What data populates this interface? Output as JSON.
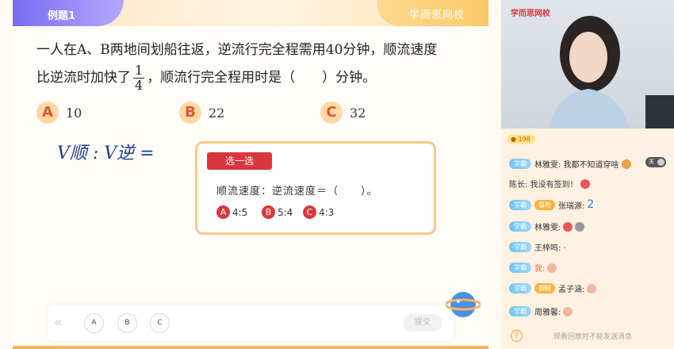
{
  "slide": {
    "tab_label": "例题1",
    "brand": "学而思网校",
    "question_line1": "一人在A、B两地间划船往返，逆流行完全程需用40分钟，顺流速度",
    "question_line2_pre": "比逆流时加快了",
    "fraction": {
      "numerator": "1",
      "denominator": "4"
    },
    "question_line2_post": "，顺流行完全程用时是（　　）分钟。",
    "options": [
      {
        "letter": "A",
        "value": "10"
      },
      {
        "letter": "B",
        "value": "22"
      },
      {
        "letter": "C",
        "value": "32"
      }
    ],
    "handwriting_text": "V顺 : V逆 =",
    "quiz": {
      "tag": "选一选",
      "prompt": "顺流速度：逆流速度＝（　　）。",
      "choices": [
        {
          "letter": "A",
          "value": "4:5"
        },
        {
          "letter": "B",
          "value": "5:4"
        },
        {
          "letter": "C",
          "value": "4:3"
        }
      ]
    },
    "answer_bar": {
      "collapse_icon": "double-chevron-left-icon",
      "buttons": [
        "A",
        "B",
        "C"
      ],
      "submit_label": "提交"
    }
  },
  "panel": {
    "video_brand": "学而思网校",
    "viewer_count": "198",
    "toggle_label": "关",
    "messages": [
      {
        "role": "学霸",
        "level": "",
        "text": "林雅雯: 我都不知道穿啥"
      },
      {
        "role": "",
        "level": "",
        "text": "陈长: 我没有签到！"
      },
      {
        "role": "学霸",
        "level": "冒险",
        "text": "张瑞源:"
      },
      {
        "role": "学霸",
        "level": "",
        "text": "林雅雯:"
      },
      {
        "role": "学霸",
        "level": "",
        "text": "王梓鸣: ·"
      },
      {
        "role": "学霸",
        "level": "",
        "text": "我:"
      },
      {
        "role": "学霸",
        "level": "钢精",
        "text": "孟子涵:"
      },
      {
        "role": "学霸",
        "level": "",
        "text": "周雅馨:"
      }
    ],
    "help_icon": "question-circle-icon",
    "replay_notice": "观看回放时不能发送消息"
  }
}
